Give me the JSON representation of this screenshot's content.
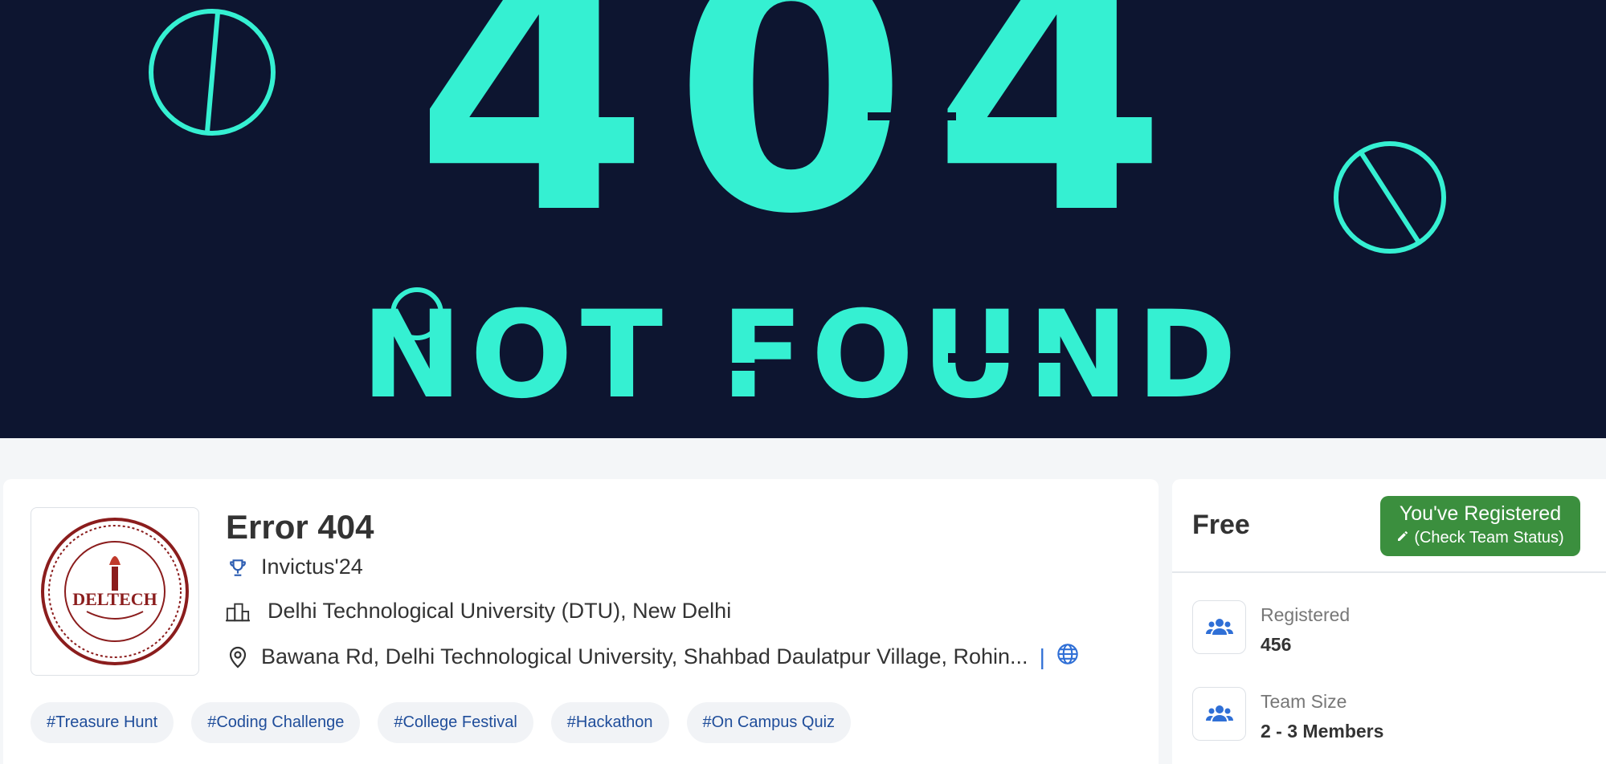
{
  "banner": {
    "headline": "404",
    "subline": "NOT FOUND",
    "accent_color": "#35f0d2",
    "bg_color": "#0d1530"
  },
  "event": {
    "title": "Error 404",
    "festival": "Invictus'24",
    "organisation": "Delhi Technological University (DTU), New Delhi",
    "address": "Bawana Rd, Delhi Technological University, Shahbad Daulatpur Village, Rohin...",
    "icons": {
      "festival": "trophy-icon",
      "organisation": "building-icon",
      "address": "location-pin-icon",
      "website": "globe-icon"
    },
    "tags": [
      "#Treasure Hunt",
      "#Coding Challenge",
      "#College Festival",
      "#Hackathon",
      "#On Campus Quiz"
    ],
    "logo": {
      "name": "DTU logo",
      "text": "DELTECH"
    }
  },
  "side": {
    "price": "Free",
    "registered_button": {
      "line1": "You've Registered",
      "line2": "(Check Team Status)",
      "color": "#3b8f3e"
    },
    "stats": [
      {
        "label": "Registered",
        "value": "456",
        "icon": "users-icon"
      },
      {
        "label": "Team Size",
        "value": "2 - 3 Members",
        "icon": "users-icon"
      }
    ]
  }
}
